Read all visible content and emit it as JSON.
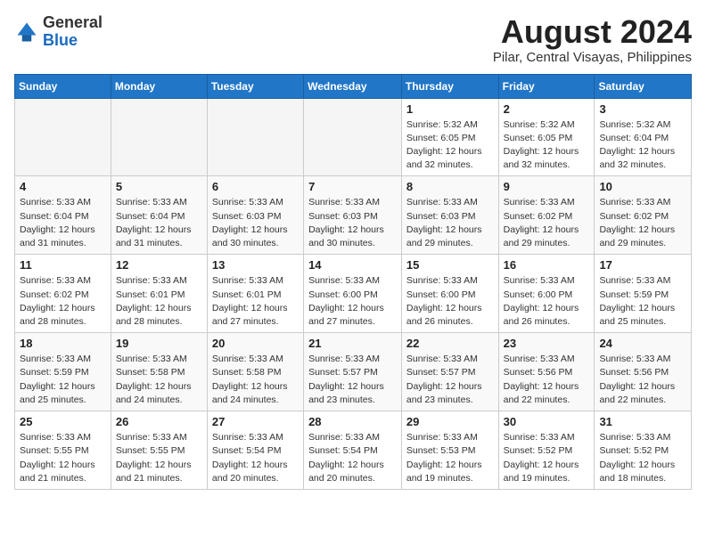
{
  "header": {
    "logo_general": "General",
    "logo_blue": "Blue",
    "month_title": "August 2024",
    "location": "Pilar, Central Visayas, Philippines"
  },
  "calendar": {
    "days_of_week": [
      "Sunday",
      "Monday",
      "Tuesday",
      "Wednesday",
      "Thursday",
      "Friday",
      "Saturday"
    ],
    "weeks": [
      [
        {
          "day": "",
          "info": ""
        },
        {
          "day": "",
          "info": ""
        },
        {
          "day": "",
          "info": ""
        },
        {
          "day": "",
          "info": ""
        },
        {
          "day": "1",
          "info": "Sunrise: 5:32 AM\nSunset: 6:05 PM\nDaylight: 12 hours\nand 32 minutes."
        },
        {
          "day": "2",
          "info": "Sunrise: 5:32 AM\nSunset: 6:05 PM\nDaylight: 12 hours\nand 32 minutes."
        },
        {
          "day": "3",
          "info": "Sunrise: 5:32 AM\nSunset: 6:04 PM\nDaylight: 12 hours\nand 32 minutes."
        }
      ],
      [
        {
          "day": "4",
          "info": "Sunrise: 5:33 AM\nSunset: 6:04 PM\nDaylight: 12 hours\nand 31 minutes."
        },
        {
          "day": "5",
          "info": "Sunrise: 5:33 AM\nSunset: 6:04 PM\nDaylight: 12 hours\nand 31 minutes."
        },
        {
          "day": "6",
          "info": "Sunrise: 5:33 AM\nSunset: 6:03 PM\nDaylight: 12 hours\nand 30 minutes."
        },
        {
          "day": "7",
          "info": "Sunrise: 5:33 AM\nSunset: 6:03 PM\nDaylight: 12 hours\nand 30 minutes."
        },
        {
          "day": "8",
          "info": "Sunrise: 5:33 AM\nSunset: 6:03 PM\nDaylight: 12 hours\nand 29 minutes."
        },
        {
          "day": "9",
          "info": "Sunrise: 5:33 AM\nSunset: 6:02 PM\nDaylight: 12 hours\nand 29 minutes."
        },
        {
          "day": "10",
          "info": "Sunrise: 5:33 AM\nSunset: 6:02 PM\nDaylight: 12 hours\nand 29 minutes."
        }
      ],
      [
        {
          "day": "11",
          "info": "Sunrise: 5:33 AM\nSunset: 6:02 PM\nDaylight: 12 hours\nand 28 minutes."
        },
        {
          "day": "12",
          "info": "Sunrise: 5:33 AM\nSunset: 6:01 PM\nDaylight: 12 hours\nand 28 minutes."
        },
        {
          "day": "13",
          "info": "Sunrise: 5:33 AM\nSunset: 6:01 PM\nDaylight: 12 hours\nand 27 minutes."
        },
        {
          "day": "14",
          "info": "Sunrise: 5:33 AM\nSunset: 6:00 PM\nDaylight: 12 hours\nand 27 minutes."
        },
        {
          "day": "15",
          "info": "Sunrise: 5:33 AM\nSunset: 6:00 PM\nDaylight: 12 hours\nand 26 minutes."
        },
        {
          "day": "16",
          "info": "Sunrise: 5:33 AM\nSunset: 6:00 PM\nDaylight: 12 hours\nand 26 minutes."
        },
        {
          "day": "17",
          "info": "Sunrise: 5:33 AM\nSunset: 5:59 PM\nDaylight: 12 hours\nand 25 minutes."
        }
      ],
      [
        {
          "day": "18",
          "info": "Sunrise: 5:33 AM\nSunset: 5:59 PM\nDaylight: 12 hours\nand 25 minutes."
        },
        {
          "day": "19",
          "info": "Sunrise: 5:33 AM\nSunset: 5:58 PM\nDaylight: 12 hours\nand 24 minutes."
        },
        {
          "day": "20",
          "info": "Sunrise: 5:33 AM\nSunset: 5:58 PM\nDaylight: 12 hours\nand 24 minutes."
        },
        {
          "day": "21",
          "info": "Sunrise: 5:33 AM\nSunset: 5:57 PM\nDaylight: 12 hours\nand 23 minutes."
        },
        {
          "day": "22",
          "info": "Sunrise: 5:33 AM\nSunset: 5:57 PM\nDaylight: 12 hours\nand 23 minutes."
        },
        {
          "day": "23",
          "info": "Sunrise: 5:33 AM\nSunset: 5:56 PM\nDaylight: 12 hours\nand 22 minutes."
        },
        {
          "day": "24",
          "info": "Sunrise: 5:33 AM\nSunset: 5:56 PM\nDaylight: 12 hours\nand 22 minutes."
        }
      ],
      [
        {
          "day": "25",
          "info": "Sunrise: 5:33 AM\nSunset: 5:55 PM\nDaylight: 12 hours\nand 21 minutes."
        },
        {
          "day": "26",
          "info": "Sunrise: 5:33 AM\nSunset: 5:55 PM\nDaylight: 12 hours\nand 21 minutes."
        },
        {
          "day": "27",
          "info": "Sunrise: 5:33 AM\nSunset: 5:54 PM\nDaylight: 12 hours\nand 20 minutes."
        },
        {
          "day": "28",
          "info": "Sunrise: 5:33 AM\nSunset: 5:54 PM\nDaylight: 12 hours\nand 20 minutes."
        },
        {
          "day": "29",
          "info": "Sunrise: 5:33 AM\nSunset: 5:53 PM\nDaylight: 12 hours\nand 19 minutes."
        },
        {
          "day": "30",
          "info": "Sunrise: 5:33 AM\nSunset: 5:52 PM\nDaylight: 12 hours\nand 19 minutes."
        },
        {
          "day": "31",
          "info": "Sunrise: 5:33 AM\nSunset: 5:52 PM\nDaylight: 12 hours\nand 18 minutes."
        }
      ]
    ]
  }
}
